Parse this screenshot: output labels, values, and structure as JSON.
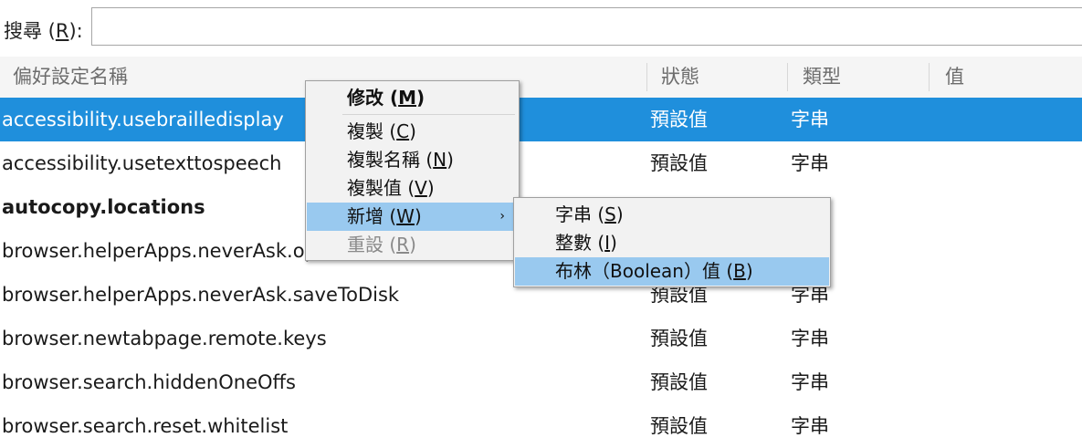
{
  "search": {
    "label_prefix": "搜尋 (",
    "label_key": "R",
    "label_suffix": "):",
    "value": ""
  },
  "columns": {
    "name": "偏好設定名稱",
    "status": "狀態",
    "type": "類型",
    "value": "值"
  },
  "rows": [
    {
      "name": "accessibility.usebrailledisplay",
      "status": "預設值",
      "type": "字串",
      "selected": true
    },
    {
      "name": "accessibility.usetexttospeech",
      "status": "預設值",
      "type": "字串"
    },
    {
      "name": "autocopy.locations",
      "status": "",
      "type": "",
      "bold": true
    },
    {
      "name": "browser.helperApps.neverAsk.openFile",
      "status": "",
      "type": ""
    },
    {
      "name": "browser.helperApps.neverAsk.saveToDisk",
      "status": "預設值",
      "type": "字串"
    },
    {
      "name": "browser.newtabpage.remote.keys",
      "status": "預設值",
      "type": "字串"
    },
    {
      "name": "browser.search.hiddenOneOffs",
      "status": "預設值",
      "type": "字串"
    },
    {
      "name": "browser.search.reset.whitelist",
      "status": "預設值",
      "type": "字串"
    }
  ],
  "context_menu": {
    "modify": {
      "pre": "修改 (",
      "key": "M",
      "post": ")"
    },
    "copy": {
      "pre": "複製 (",
      "key": "C",
      "post": ")"
    },
    "copy_name": {
      "pre": "複製名稱 (",
      "key": "N",
      "post": ")"
    },
    "copy_value": {
      "pre": "複製值 (",
      "key": "V",
      "post": ")"
    },
    "new": {
      "pre": "新增 (",
      "key": "W",
      "post": ")"
    },
    "reset": {
      "pre": "重設 (",
      "key": "R",
      "post": ")"
    },
    "submenu_arrow": "›"
  },
  "submenu": {
    "string": {
      "pre": "字串 (",
      "key": "S",
      "post": ")"
    },
    "integer": {
      "pre": "整數 (",
      "key": "I",
      "post": ")"
    },
    "boolean": {
      "pre": "布林（Boolean）值 (",
      "key": "B",
      "post": ")"
    }
  },
  "colors": {
    "selection": "#1f8fdc",
    "menu_highlight": "#99c9ef"
  }
}
